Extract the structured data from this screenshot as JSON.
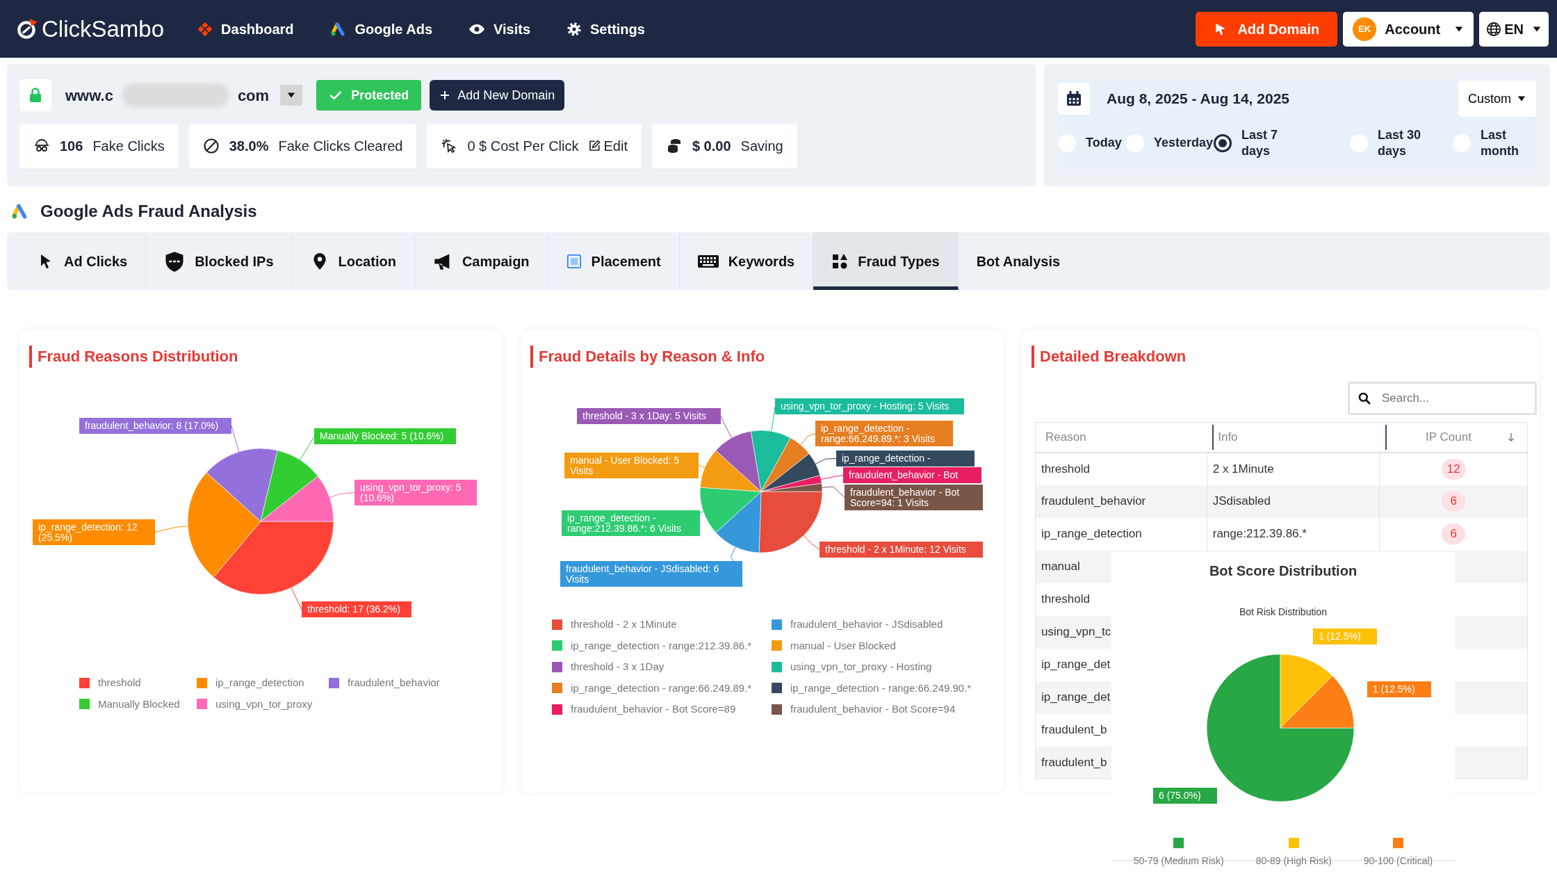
{
  "navbar": {
    "logo": "ClickSambo",
    "items": [
      "Dashboard",
      "Google Ads",
      "Visits",
      "Settings"
    ],
    "add_domain": "Add Domain",
    "account": {
      "initials": "EK",
      "label": "Account"
    },
    "language": "EN"
  },
  "domain_panel": {
    "domain_start": "www.c",
    "domain_end": "com",
    "status": "Protected",
    "add_button": "Add New Domain",
    "stats": [
      {
        "kind": "metric",
        "value": "106",
        "label": "Fake Clicks"
      },
      {
        "kind": "metric",
        "value": "38.0%",
        "label": "Fake Clicks Cleared"
      },
      {
        "kind": "editable",
        "label": "0 $ Cost Per Click",
        "action": "Edit"
      },
      {
        "kind": "metric",
        "value": "$ 0.00",
        "label": "Saving"
      }
    ]
  },
  "date_panel": {
    "range": "Aug 8, 2025 - Aug 14, 2025",
    "preset": "Custom",
    "options": [
      {
        "label": "Today",
        "selected": false
      },
      {
        "label": "Yesterday",
        "selected": false
      },
      {
        "label": "Last 7 days",
        "selected": true
      },
      {
        "label": "Last 30 days",
        "selected": false
      },
      {
        "label": "Last month",
        "selected": false
      }
    ]
  },
  "section_title": "Google Ads Fraud Analysis",
  "tabs": [
    {
      "label": "Ad Clicks",
      "selected": false
    },
    {
      "label": "Blocked IPs",
      "selected": false
    },
    {
      "label": "Location",
      "selected": false
    },
    {
      "label": "Campaign",
      "selected": false
    },
    {
      "label": "Placement",
      "selected": false
    },
    {
      "label": "Keywords",
      "selected": false
    },
    {
      "label": "Fraud Types",
      "selected": true
    },
    {
      "label": "Bot Analysis",
      "selected": false
    }
  ],
  "fraud_reasons": {
    "title": "Fraud Reasons Distribution",
    "chart_data": {
      "type": "pie",
      "categories": [
        "threshold",
        "ip_range_detection",
        "fraudulent_behavior",
        "Manually Blocked",
        "using_vpn_tor_proxy"
      ],
      "values": [
        17,
        12,
        8,
        5,
        5
      ],
      "colors": [
        "#ff4136",
        "#ff8c00",
        "#9370db",
        "#32cd32",
        "#ff69b4"
      ],
      "value_labels": [
        "threshold: 17 (36.2%)",
        "ip_range_detection: 12 (25.5%)",
        "fraudulent_behavior: 8 (17.0%)",
        "Manually Blocked: 5 (10.6%)",
        "using_vpn_tor_proxy: 5 (10.6%)"
      ]
    }
  },
  "fraud_details": {
    "title": "Fraud Details by Reason & Info",
    "chart_data": {
      "type": "pie",
      "categories": [
        "threshold - 2 x 1Minute",
        "fraudulent_behavior - JSdisabled",
        "ip_range_detection - range:212.39.86.*",
        "manual - User Blocked",
        "threshold - 3 x 1Day",
        "using_vpn_tor_proxy - Hosting",
        "ip_range_detection - range:66.249.89.*",
        "ip_range_detection - range:66.249.90.*",
        "fraudulent_behavior - Bot Score=89",
        "fraudulent_behavior - Bot Score=94"
      ],
      "values": [
        12,
        6,
        6,
        5,
        5,
        5,
        3,
        3,
        1,
        1
      ],
      "colors": [
        "#e74c3c",
        "#3498db",
        "#2ecc71",
        "#f39c12",
        "#9b59b6",
        "#1abc9c",
        "#e67e22",
        "#34495e",
        "#e91e63",
        "#795548"
      ],
      "value_labels": [
        "threshold - 2 x 1Minute: 12 Visits",
        "fraudulent_behavior - JSdisabled: 6 Visits",
        "ip_range_detection - range:212.39.86.*: 6 Visits",
        "manual - User Blocked: 5 Visits",
        "threshold - 3 x 1Day: 5 Visits",
        "using_vpn_tor_proxy - Hosting: 5 Visits",
        "ip_range_detection - range:66.249.89.*: 3 Visits",
        "ip_range_detection -",
        "fraudulent_behavior - Bot",
        "fraudulent_behavior - Bot Score=94: 1 Visits"
      ]
    }
  },
  "breakdown": {
    "title": "Detailed Breakdown",
    "search_placeholder": "Search...",
    "columns": [
      "Reason",
      "Info",
      "IP Count"
    ],
    "rows": [
      {
        "reason": "threshold",
        "info": "2 x 1Minute",
        "count": "12"
      },
      {
        "reason": "fraudulent_behavior",
        "info": "JSdisabled",
        "count": "6"
      },
      {
        "reason": "ip_range_detection",
        "info": "range:212.39.86.*",
        "count": "6"
      },
      {
        "reason": "manual"
      },
      {
        "reason": "threshold"
      },
      {
        "reason": "using_vpn_tc"
      },
      {
        "reason": "ip_range_det"
      },
      {
        "reason": "ip_range_det"
      },
      {
        "reason": "fraudulent_b"
      },
      {
        "reason": "fraudulent_b"
      }
    ]
  },
  "bot_popup": {
    "title": "Bot Score Distribution",
    "chart_data": {
      "type": "pie",
      "title": "Bot Risk Distribution",
      "categories": [
        "50-79 (Medium Risk)",
        "80-89 (High Risk)",
        "90-100 (Critical)"
      ],
      "values": [
        6,
        1,
        1
      ],
      "colors": [
        "#28a745",
        "#ffc107",
        "#fd7e14"
      ],
      "value_labels": [
        "6 (75.0%)",
        "1 (12.5%)",
        "1 (12.5%)"
      ]
    }
  }
}
